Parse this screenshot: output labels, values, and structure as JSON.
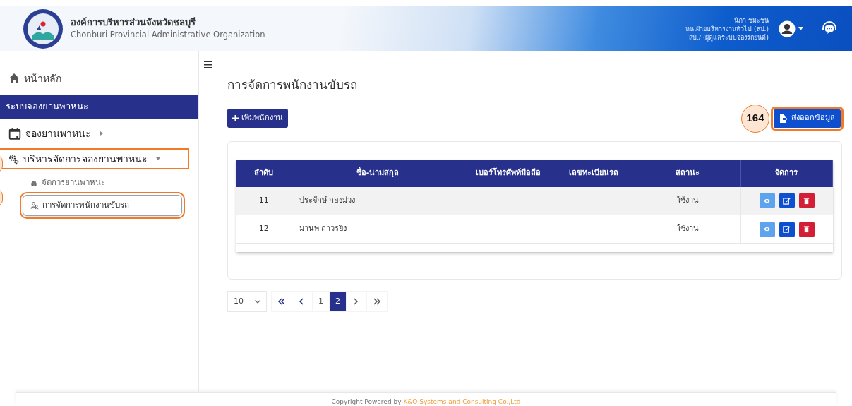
{
  "header": {
    "title": "องค์การบริหารส่วนจังหวัดชลบุรี",
    "subtitle": "Chonburi Provincial Administrative Organization",
    "user_lines": [
      "นิภา ชมะชน",
      "หน.ฝ่ายบริหารงานทั่วไป (สป.)",
      "สป./ (ผู้ดูแลระบบจองรถยนต์)"
    ]
  },
  "sidebar": {
    "items": [
      {
        "kind": "link",
        "label": "หน้าหลัก"
      },
      {
        "kind": "section",
        "label": "ระบบจองยานพาหนะ"
      },
      {
        "kind": "menu",
        "label": "จองยานพาหนะ",
        "expanded": false
      },
      {
        "kind": "menu",
        "label": "บริหารจัดการจองยานพาหนะ",
        "expanded": true,
        "annotated": true,
        "children": [
          {
            "label": "จัดการยานพาหนะ",
            "selected": false
          },
          {
            "label": "การจัดการพนักงานขับรถ",
            "selected": true,
            "annotated": true
          }
        ]
      }
    ]
  },
  "page": {
    "title": "การจัดการพนักงานขับรถ",
    "add_button": "เพิ่มพนักงาน",
    "export_button": {
      "label": "ส่งออกข้อมูล",
      "annotated": true,
      "callout": "164"
    }
  },
  "table": {
    "columns": [
      "ลำดับ",
      "ชื่อ-นามสกุล",
      "เบอร์โทรศัพท์มือถือ",
      "เลขทะเบียนรถ",
      "สถานะ",
      "จัดการ"
    ],
    "rows": [
      {
        "cells": [
          "11",
          "ประจักษ์ กองม่วง",
          "",
          "",
          "ใช้งาน"
        ]
      },
      {
        "cells": [
          "12",
          "มานพ ถาวรยิ่ง",
          "",
          "",
          "ใช้งาน"
        ]
      }
    ]
  },
  "pagination": {
    "page_size": "10",
    "buttons": [
      {
        "kind": "first",
        "selected": false
      },
      {
        "kind": "prev",
        "selected": false
      },
      {
        "kind": "page",
        "label": "1",
        "selected": false
      },
      {
        "kind": "page",
        "label": "2",
        "selected": true
      },
      {
        "kind": "next",
        "selected": false
      },
      {
        "kind": "last",
        "selected": false
      }
    ]
  },
  "footer": {
    "text": "Copyright Powered by",
    "link": "K&O Systems and Consulting Co.,Ltd"
  }
}
